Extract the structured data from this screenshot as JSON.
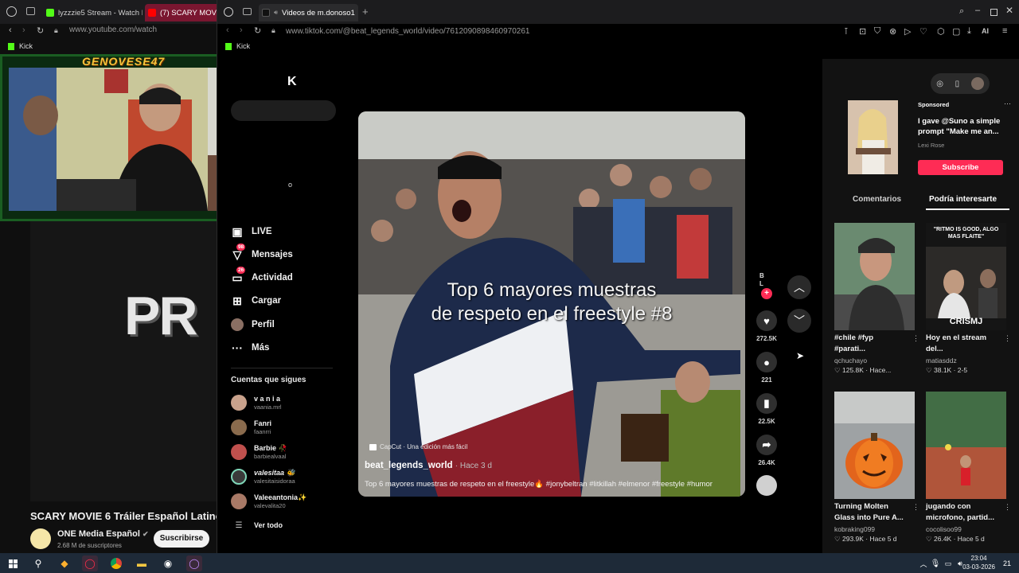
{
  "back_window": {
    "tabs": [
      {
        "label": "lyzzzie5 Stream - Watch L"
      },
      {
        "label": "(7) SCARY MOVIE 6"
      }
    ],
    "url": "www.youtube.com/watch",
    "bookmark": "Kick",
    "webcam_name": "GENOVESE47",
    "video_overlay_text": "PR",
    "video_title": "SCARY MOVIE 6 Tráiler Español Latino",
    "channel": "ONE Media Español",
    "subscribers": "2.68 M de suscriptores",
    "subscribe_label": "Suscribirse"
  },
  "front_window": {
    "tab_label": "Videos de m.donoso1",
    "url": "www.tiktok.com/@beat_legends_world/video/7612090898460970261",
    "bookmark": "Kick",
    "toolbar_ai": "AI"
  },
  "sidebar": {
    "items": [
      {
        "label": "LIVE",
        "icon": "live-icon"
      },
      {
        "label": "Mensajes",
        "icon": "messages-icon",
        "badge": "98"
      },
      {
        "label": "Actividad",
        "icon": "activity-icon",
        "badge": "26"
      },
      {
        "label": "Cargar",
        "icon": "upload-icon"
      },
      {
        "label": "Perfil",
        "icon": "profile-icon"
      },
      {
        "label": "Más",
        "icon": "more-icon"
      }
    ],
    "following_title": "Cuentas que sigues",
    "accounts": [
      {
        "name": "v a n i a",
        "handle": "vaania.mrl",
        "color": "#c9a28c"
      },
      {
        "name": "Fanri",
        "handle": "faanrri",
        "color": "#8a6b4d"
      },
      {
        "name": "Barbie 🥀",
        "handle": "barbiealvaal",
        "color": "#c0504d"
      },
      {
        "name": "valesitaa 🐝",
        "handle": "valesitaisidoraa",
        "color": "#3a3a3a"
      },
      {
        "name": "Valeeantonia✨",
        "handle": "valevalita20",
        "color": "#a87966"
      }
    ],
    "see_all": "Ver todo"
  },
  "video": {
    "caption_line1": "Top 6 mayores muestras",
    "caption_line2": "de respeto en el freestyle #8",
    "capcut": "CapCut · Una edición más fácil",
    "author": "beat_legends_world",
    "time": "· Hace 3 d",
    "description": "Top 6 mayores muestras de respeto en el freestyle🔥 #jonybeltran #litkillah #elmenor #freestyle #humor",
    "likes": "272.5K",
    "comments": "221",
    "saves": "22.5K",
    "shares": "26.4K"
  },
  "right_panel": {
    "sponsored": "Sponsored",
    "ad_text": "I gave @Suno a simple prompt \"Make me an...",
    "ad_author": "Lexi Rose",
    "ad_button": "Subscribe",
    "tab_comments": "Comentarios",
    "tab_interest": "Podría interesarte",
    "cards": [
      {
        "title1": "#chile #fyp",
        "title2": "#parati...",
        "user": "qchuchayo",
        "stats": "125.8K · Hace..."
      },
      {
        "title1": "Hoy en el stream",
        "title2": "del...",
        "user": "matiasddz",
        "stats": "38.1K · 2-5",
        "overlay_top": "\"RITMO IS GOOD, ALGO MAS FLAITE\"",
        "overlay_bottom": "CRISMJ"
      },
      {
        "title1": "Turning Molten",
        "title2": "Glass into Pure A...",
        "user": "kobraking099",
        "stats": "293.9K · Hace 5 d"
      },
      {
        "title1": "jugando con",
        "title2": "microfono, partid...",
        "user": "cocolisoo99",
        "stats": "26.4K · Hace 5 d"
      }
    ]
  },
  "taskbar": {
    "time": "23:04",
    "date": "03-03-2026",
    "notifications": "21"
  }
}
